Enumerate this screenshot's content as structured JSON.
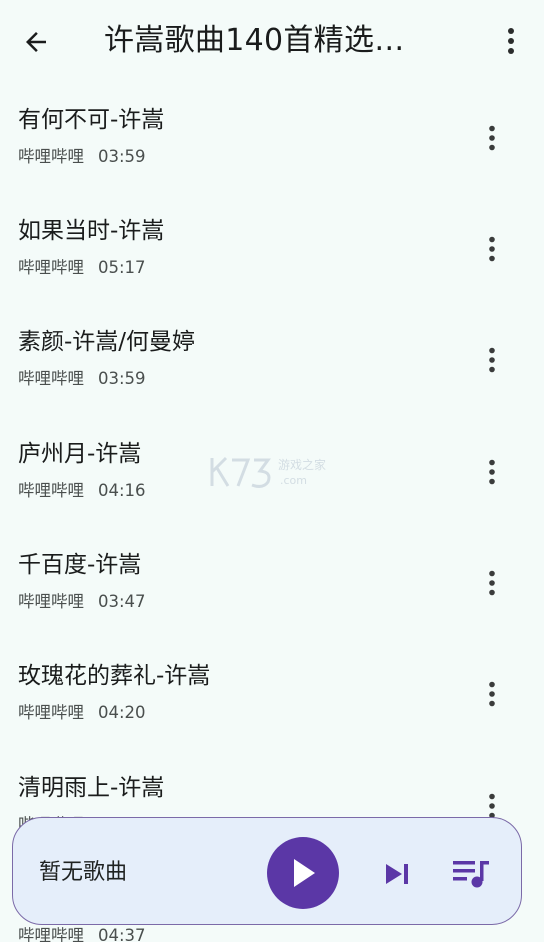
{
  "header": {
    "title": "许嵩歌曲140首精选…",
    "back_icon": "arrow-left-icon",
    "more_icon": "more-vert-icon"
  },
  "songs": [
    {
      "title": "有何不可-许嵩",
      "source": "哔哩哔哩",
      "duration": "03:59"
    },
    {
      "title": "如果当时-许嵩",
      "source": "哔哩哔哩",
      "duration": "05:17"
    },
    {
      "title": "素颜-许嵩/何曼婷",
      "source": "哔哩哔哩",
      "duration": "03:59"
    },
    {
      "title": "庐州月-许嵩",
      "source": "哔哩哔哩",
      "duration": "04:16"
    },
    {
      "title": "千百度-许嵩",
      "source": "哔哩哔哩",
      "duration": "03:47"
    },
    {
      "title": "玫瑰花的葬礼-许嵩",
      "source": "哔哩哔哩",
      "duration": "04:20"
    },
    {
      "title": "清明雨上-许嵩",
      "source": "哔哩哔哩",
      "duration": ""
    },
    {
      "title": "",
      "source": "哔哩哔哩",
      "duration": "04:37"
    }
  ],
  "watermark": {
    "logo": "K73",
    "text": "游戏之家",
    "domain": ".com"
  },
  "player": {
    "now_playing": "暂无歌曲",
    "play_icon": "play-icon",
    "next_icon": "skip-next-icon",
    "queue_icon": "queue-music-icon"
  },
  "colors": {
    "background": "#f4fbf9",
    "accent": "#5b37a6",
    "player_background": "#e5eefa",
    "player_border": "#7b6aa8",
    "text_primary": "#1a1c1c",
    "text_secondary": "#4a4f4e"
  }
}
